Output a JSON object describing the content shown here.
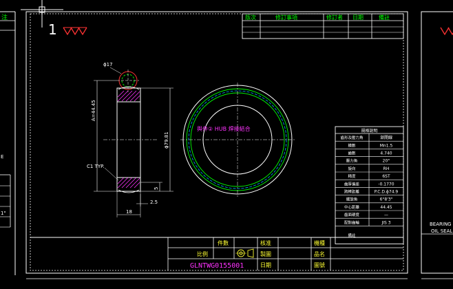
{
  "revision_table": {
    "headers": [
      "版次",
      "修訂事項",
      "修訂者",
      "日期",
      "備註"
    ]
  },
  "sheet_number": "1",
  "left_panel_text": "注",
  "dimensions": {
    "top_dia": "ϕ17",
    "height": "A=44.45",
    "od": "ϕ79.81",
    "chamfer": "C1 TYP.",
    "small": "5",
    "offset": "2.5",
    "width": "18"
  },
  "hub_note": "與件② HUB 焊接結合",
  "spec_table": {
    "title": "規格說明",
    "rows": [
      [
        "齒形及壓力角",
        "漸開線"
      ],
      [
        "模數",
        "Mn1.5"
      ],
      [
        "齒數",
        "4.740"
      ],
      [
        "壓力角",
        "20°"
      ],
      [
        "旋向",
        "RH"
      ],
      [
        "精度",
        "6ST"
      ],
      [
        "齒厚偏差",
        "-0.1770"
      ],
      [
        "跨棒距離",
        "P.C.D.ϕ74.9"
      ],
      [
        "螺旋角",
        "6°8'3\""
      ],
      [
        "中心距離",
        "44.45"
      ],
      [
        "齒面硬度",
        "—"
      ],
      [
        "配對齒輪",
        "JIS 3"
      ],
      [
        "備註",
        ""
      ]
    ]
  },
  "title_block": {
    "row1": [
      "件數",
      "核准",
      "機種"
    ],
    "row2": [
      "比例",
      "製圖",
      "品名"
    ],
    "row3": [
      "日期",
      "圖號"
    ],
    "drawing_number": "GLNTWG0155001"
  },
  "right_panel": {
    "line1": "BEARING",
    "line2": "OIL SEAL"
  },
  "left_panel_value": "1\""
}
